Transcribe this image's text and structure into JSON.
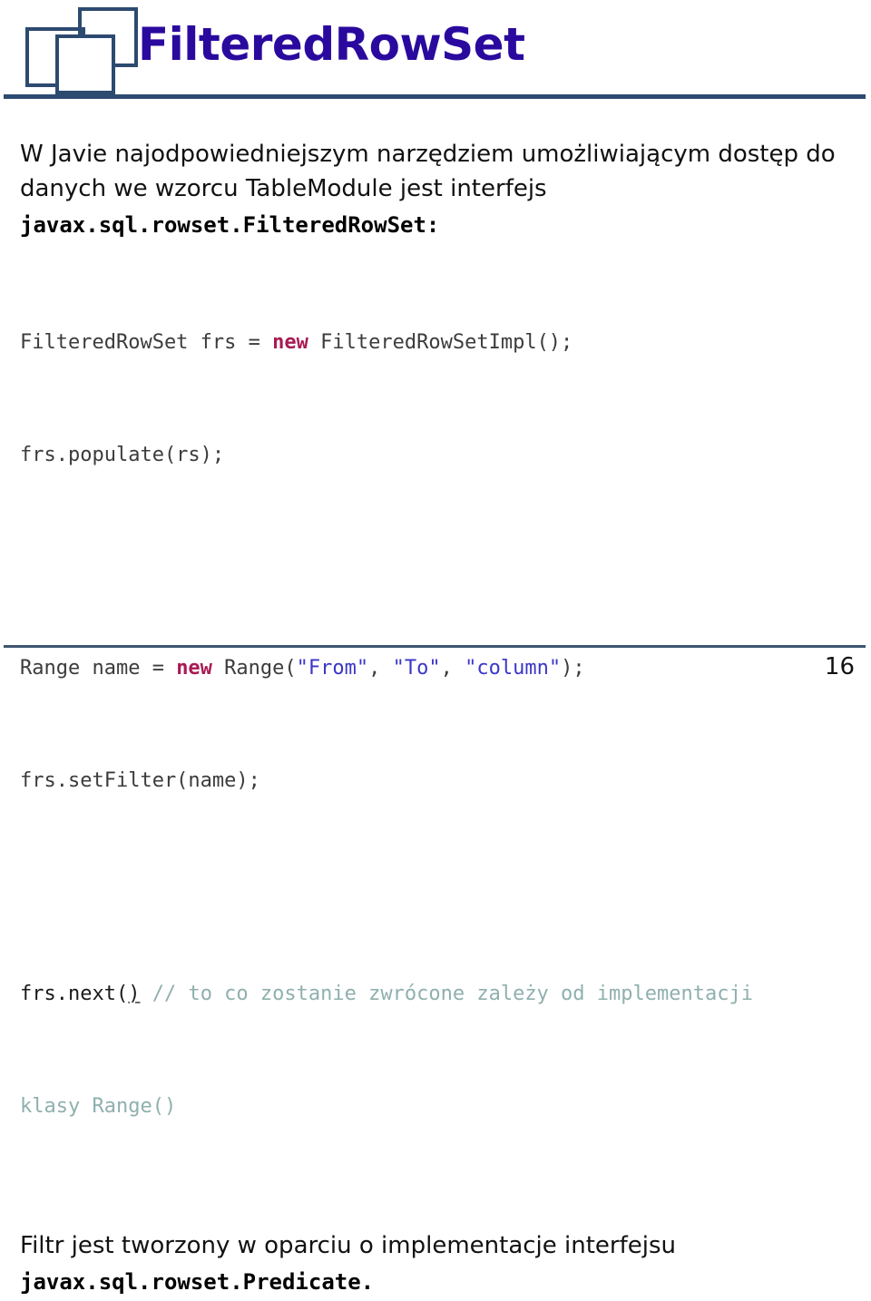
{
  "slide": {
    "title": "FilteredRowSet",
    "page_number": "16",
    "title_color": "#2a0a9e",
    "rule_color": "#2d4a70",
    "logo_color": "#2d4a70"
  },
  "intro": {
    "text": "W Javie najodpowiedniejszym narzędziem umożliwiającym dostęp do danych we wzorcu TableModule jest interfejs",
    "interface_name": "javax.sql.rowset.FilteredRowSet:"
  },
  "code": {
    "line1_a": "FilteredRowSet frs = ",
    "line1_kw": "new",
    "line1_b": " FilteredRowSetImpl();",
    "line2": "frs.populate(rs);",
    "line3_a": "Range name = ",
    "line3_kw": "new",
    "line3_b": " Range(",
    "line3_s1": "\"From\"",
    "line3_c1": ", ",
    "line3_s2": "\"To\"",
    "line3_c2": ", ",
    "line3_s3": "\"column\"",
    "line3_d": ");",
    "line4": "frs.setFilter(name);",
    "line5_a": "frs.next(",
    "line5_paren": ")",
    "line5_comment": " // to co zostanie zwrócone zależy od implementacji",
    "line6_comment": "klasy Range()"
  },
  "outro": {
    "text": "Filtr jest tworzony w oparciu o implementacje interfejsu",
    "interface_name": "javax.sql.rowset.Predicate."
  },
  "colors": {
    "keyword": "#a81b54",
    "string": "#3b36c8",
    "comment": "#8fb0ad",
    "code_plain": "#3c3c3c"
  }
}
